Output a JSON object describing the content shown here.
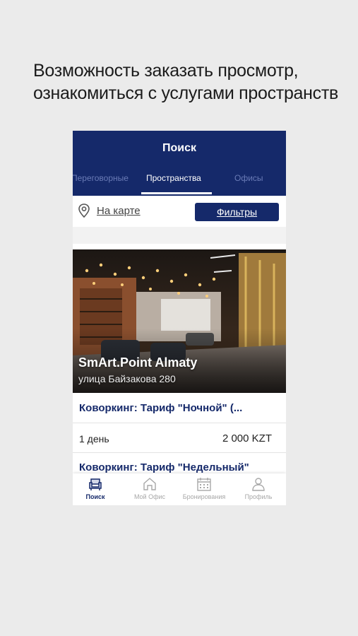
{
  "caption": {
    "line1": "Возможность заказать просмотр,",
    "line2": "ознакомиться с услугами пространств"
  },
  "header": {
    "title": "Поиск",
    "tabs": [
      {
        "label": "Переговорные",
        "active": false
      },
      {
        "label": "Пространства",
        "active": true
      },
      {
        "label": "Офисы",
        "active": false
      }
    ]
  },
  "toolbar": {
    "map_label": "На карте",
    "map_icon": "location-pin-icon",
    "filters_label": "Фильтры"
  },
  "listing": {
    "name": "SmArt.Point Almaty",
    "address": "улица Байзакова 280",
    "tariffs": [
      {
        "title": "Коворкинг: Тариф \"Ночной\" (...",
        "period": "1 день",
        "price": "2 000 KZT"
      },
      {
        "title": "Коворкинг: Тариф \"Недельный\""
      }
    ]
  },
  "bottom_nav": [
    {
      "label": "Поиск",
      "icon": "armchair-icon",
      "active": true
    },
    {
      "label": "Мой Офис",
      "icon": "home-icon",
      "active": false
    },
    {
      "label": "Бронирования",
      "icon": "calendar-icon",
      "active": false
    },
    {
      "label": "Профиль",
      "icon": "user-icon",
      "active": false
    }
  ],
  "colors": {
    "primary": "#15296a",
    "background": "#ebebeb",
    "inactive_tab": "#6a7bb6",
    "inactive_nav": "#a7a7a7"
  }
}
